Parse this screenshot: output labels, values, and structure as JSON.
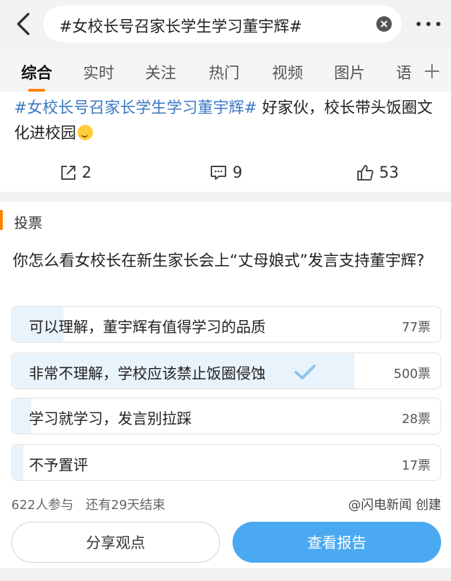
{
  "search": {
    "query": "#女校长号召家长学生学习董宇辉#"
  },
  "icons": {
    "back": "back-arrow-icon",
    "clear": "clear-icon",
    "more": "more-icon",
    "add_tab": "plus-icon",
    "repost": "repost-icon",
    "comment": "comment-icon",
    "like": "like-icon",
    "checkmark": "check-icon"
  },
  "tabs": [
    {
      "label": "综合",
      "active": true
    },
    {
      "label": "实时"
    },
    {
      "label": "关注"
    },
    {
      "label": "热门"
    },
    {
      "label": "视频"
    },
    {
      "label": "图片"
    },
    {
      "label": "语"
    }
  ],
  "post": {
    "hashtag": "#女校长号召家长学生学习董宇辉#",
    "text": " 好家伙，校长带头饭圈文化进校园",
    "reposts": "2",
    "comments": "9",
    "likes": "53"
  },
  "vote": {
    "label": "投票",
    "question": "你怎么看女校长在新生家长会上“丈母娘式”发言支持董宇辉?",
    "options": [
      {
        "text": "可以理解，董宇辉有值得学习的品质",
        "count": "77票",
        "share": 0.12
      },
      {
        "text": "非常不理解，学校应该禁止饭圈侵蚀",
        "count": "500票",
        "share": 0.8,
        "selected": true
      },
      {
        "text": "学习就学习，发言别拉踩",
        "count": "28票",
        "share": 0.045
      },
      {
        "text": "不予置评",
        "count": "17票",
        "share": 0.027
      }
    ],
    "participants": "622人参与",
    "remaining": "还有29天结束",
    "creator": "@闪电新闻 创建",
    "share_button": "分享观点",
    "report_button": "查看报告"
  },
  "colors": {
    "accent": "#ff8200",
    "hashtag": "#3a78c3",
    "button": "#4ba9f1",
    "selected_fill": "#e9f3fc"
  }
}
